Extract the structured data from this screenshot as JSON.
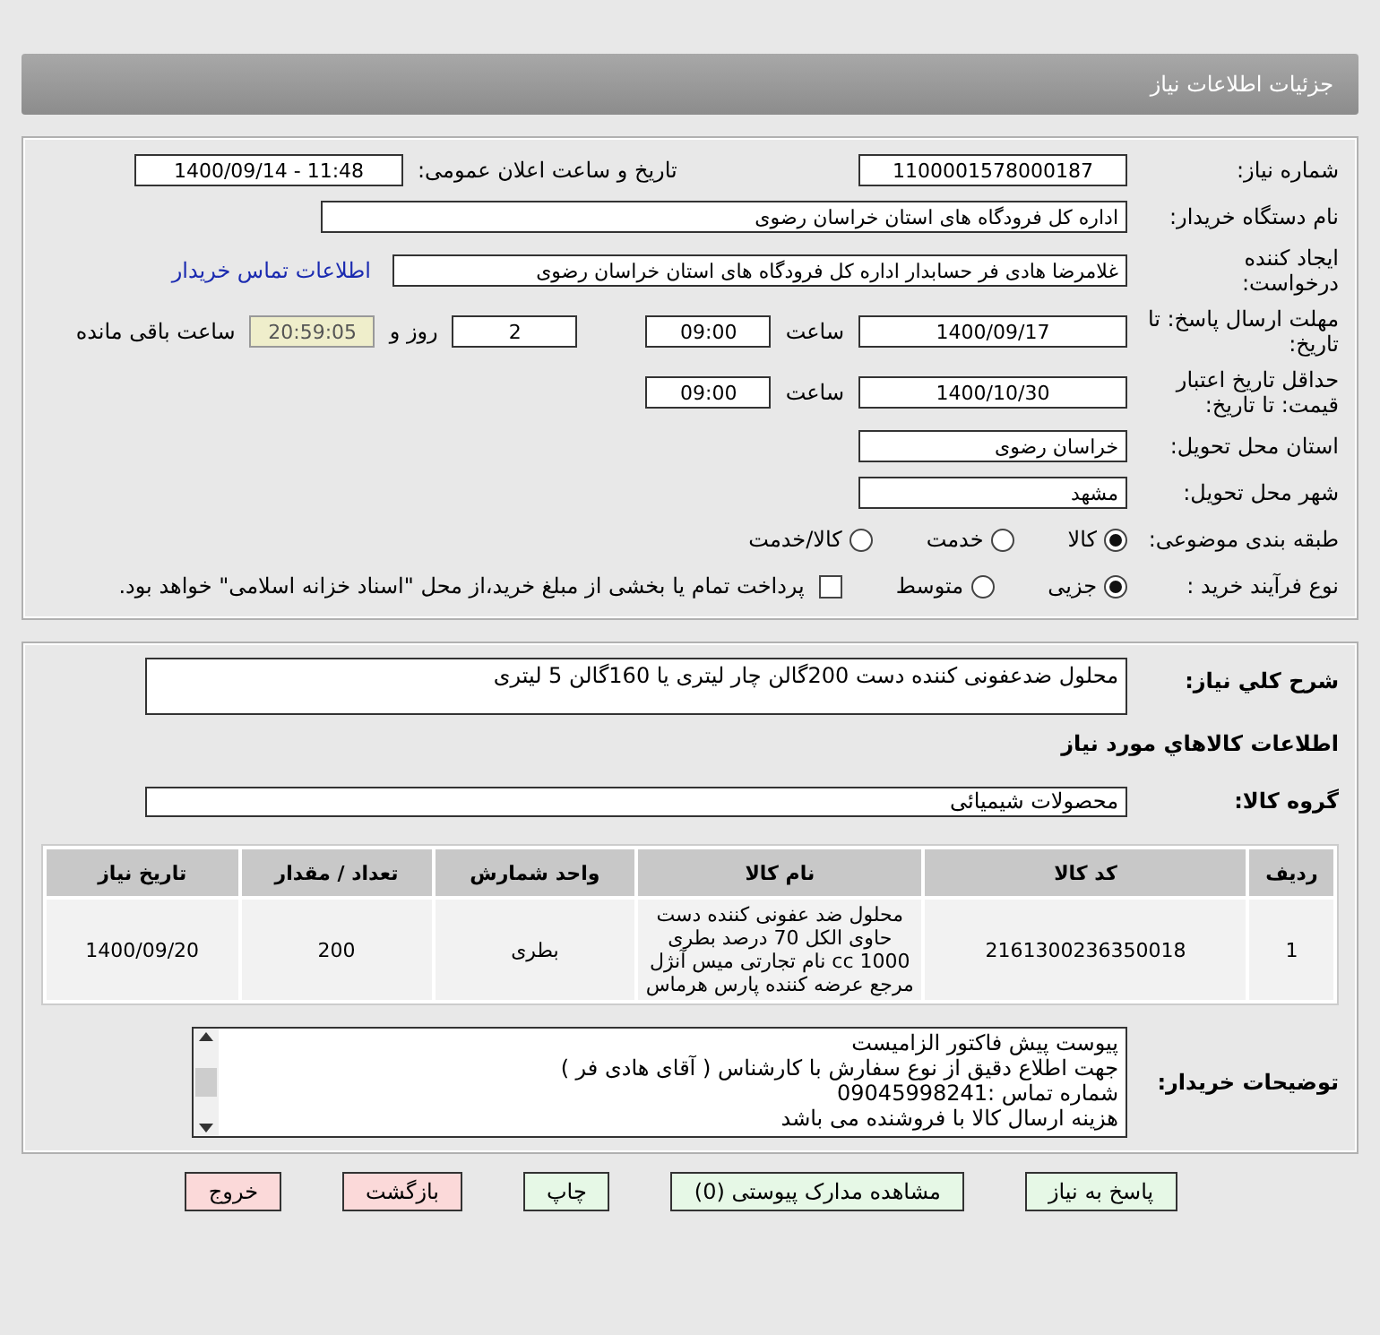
{
  "header": {
    "title": "جزئیات اطلاعات نیاز"
  },
  "details": {
    "need_number": {
      "label": "شماره نیاز:",
      "value": "1100001578000187"
    },
    "announce": {
      "label": "تاریخ و ساعت اعلان عمومی:",
      "value": "1400/09/14 - 11:48"
    },
    "buyer_org": {
      "label": "نام دستگاه خریدار:",
      "value": "اداره کل فرودگاه های استان خراسان رضوی"
    },
    "creator": {
      "label": "ایجاد کننده درخواست:",
      "value": "غلامرضا هادی فر حسابدار اداره کل فرودگاه های استان خراسان رضوی",
      "link": "اطلاعات تماس خریدار"
    },
    "deadline": {
      "label": "مهلت ارسال پاسخ: تا تاریخ:",
      "date": "1400/09/17",
      "time_label": "ساعت",
      "time": "09:00",
      "days": "2",
      "days_label": "روز و",
      "remaining": "20:59:05",
      "remaining_label": "ساعت باقی مانده"
    },
    "validity": {
      "label": "حداقل تاریخ اعتبار قیمت: تا تاریخ:",
      "date": "1400/10/30",
      "time_label": "ساعت",
      "time": "09:00"
    },
    "province": {
      "label": "استان محل تحویل:",
      "value": "خراسان رضوی"
    },
    "city": {
      "label": "شهر محل تحویل:",
      "value": "مشهد"
    },
    "category": {
      "label": "طبقه بندی موضوعی:",
      "options": [
        {
          "label": "کالا",
          "selected": true
        },
        {
          "label": "خدمت",
          "selected": false
        },
        {
          "label": "کالا/خدمت",
          "selected": false
        }
      ]
    },
    "process": {
      "label": "نوع فرآیند خرید :",
      "options": [
        {
          "label": "جزیی",
          "selected": true
        },
        {
          "label": "متوسط",
          "selected": false
        }
      ],
      "payment": {
        "checked": false,
        "label": "پرداخت تمام یا بخشی از مبلغ خرید،از محل \"اسناد خزانه اسلامی\" خواهد بود."
      }
    }
  },
  "goods": {
    "summary": {
      "label": "شرح کلي نیاز:",
      "value": "محلول ضدعفونی کننده دست  200گالن چار لیتری یا 160گالن 5 لیتری"
    },
    "section_title": "اطلاعات کالاهاي مورد نیاز",
    "group": {
      "label": "گروه کالا:",
      "value": "محصولات شیمیائی"
    },
    "table": {
      "columns": [
        "ردیف",
        "کد کالا",
        "نام کالا",
        "واحد شمارش",
        "تعداد / مقدار",
        "تاریخ نیاز"
      ],
      "rows": [
        [
          "1",
          "2161300236350018",
          "محلول ضد عفونی کننده دست حاوی الکل 70 درصد بطری 1000 cc نام تجارتی میس آنژل مرجع عرضه کننده پارس هرماس",
          "بطری",
          "200",
          "1400/09/20"
        ]
      ]
    },
    "notes": {
      "label": "توضیحات خریدار:",
      "lines": [
        "پیوست پیش فاکتور الزامیست",
        "جهت اطلاع دقیق از نوع سفارش با کارشناس   ( آقای  هادی فر )",
        "شماره تماس :09045998241",
        "هزینه ارسال کالا با فروشنده می باشد"
      ]
    }
  },
  "buttons": [
    {
      "label": "پاسخ به نیاز",
      "kind": "normal"
    },
    {
      "label": "مشاهده مدارک پیوستی (0)",
      "kind": "normal"
    },
    {
      "label": "چاپ",
      "kind": "normal"
    },
    {
      "label": "بازگشت",
      "kind": "danger"
    },
    {
      "label": "خروج",
      "kind": "danger"
    }
  ]
}
